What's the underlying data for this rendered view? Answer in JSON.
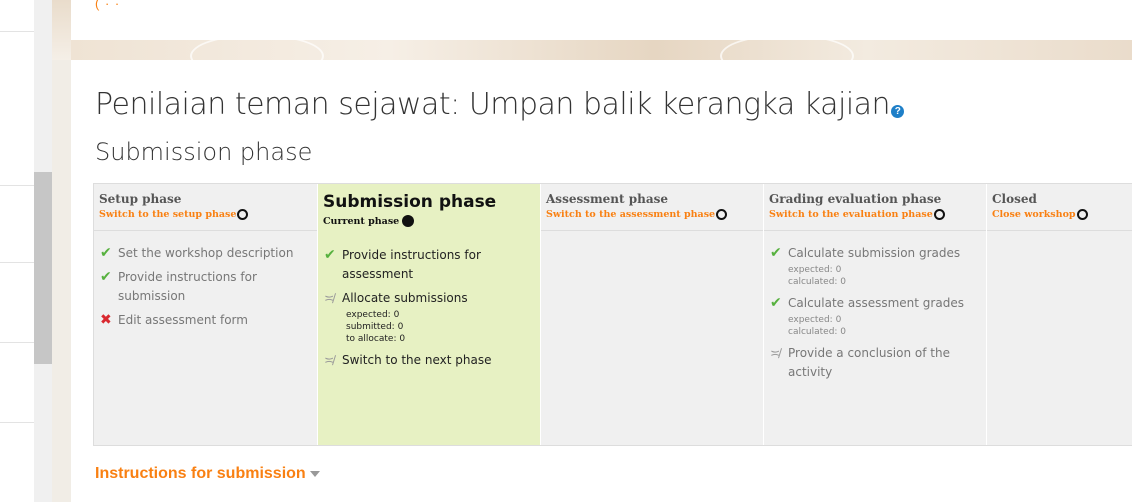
{
  "banner": {
    "text": "(                                  ·          ·"
  },
  "page": {
    "title": "Penilaian teman sejawat: Umpan balik kerangka kajian",
    "help_glyph": "?"
  },
  "current_phase_heading": "Submission phase",
  "phases": [
    {
      "title": "Setup phase",
      "action": "Switch to the setup phase",
      "tasks": [
        {
          "status": "done",
          "label": "Set the workshop description"
        },
        {
          "status": "done",
          "label": "Provide instructions for submission"
        },
        {
          "status": "fail",
          "label": "Edit assessment form"
        }
      ]
    },
    {
      "title": "Submission phase",
      "action": "Current phase",
      "active": true,
      "tasks": [
        {
          "status": "done",
          "label": "Provide instructions for assessment"
        },
        {
          "status": "todo",
          "label": "Allocate submissions",
          "details": [
            "expected: 0",
            "submitted: 0",
            "to allocate: 0"
          ]
        },
        {
          "status": "todo",
          "label": "Switch to the next phase"
        }
      ]
    },
    {
      "title": "Assessment phase",
      "action": "Switch to the assessment phase",
      "tasks": []
    },
    {
      "title": "Grading evaluation phase",
      "action": "Switch to the evaluation phase",
      "tasks": [
        {
          "status": "done",
          "label": "Calculate submission grades",
          "details": [
            "expected: 0",
            "calculated: 0"
          ]
        },
        {
          "status": "done",
          "label": "Calculate assessment grades",
          "details": [
            "expected: 0",
            "calculated: 0"
          ]
        },
        {
          "status": "todo",
          "label": "Provide a conclusion of the activity"
        }
      ]
    },
    {
      "title": "Closed",
      "action": "Close workshop",
      "tasks": []
    }
  ],
  "instructions_link": "Instructions for submission",
  "icons": {
    "done": "check-icon",
    "fail": "cross-icon",
    "todo": "pending-icon",
    "switch": "circle-icon",
    "current": "filled-circle-icon"
  },
  "colors": {
    "accent": "#f98012",
    "active_bg": "#e7f1c3",
    "done": "#57b13f",
    "fail": "#d9282f"
  }
}
